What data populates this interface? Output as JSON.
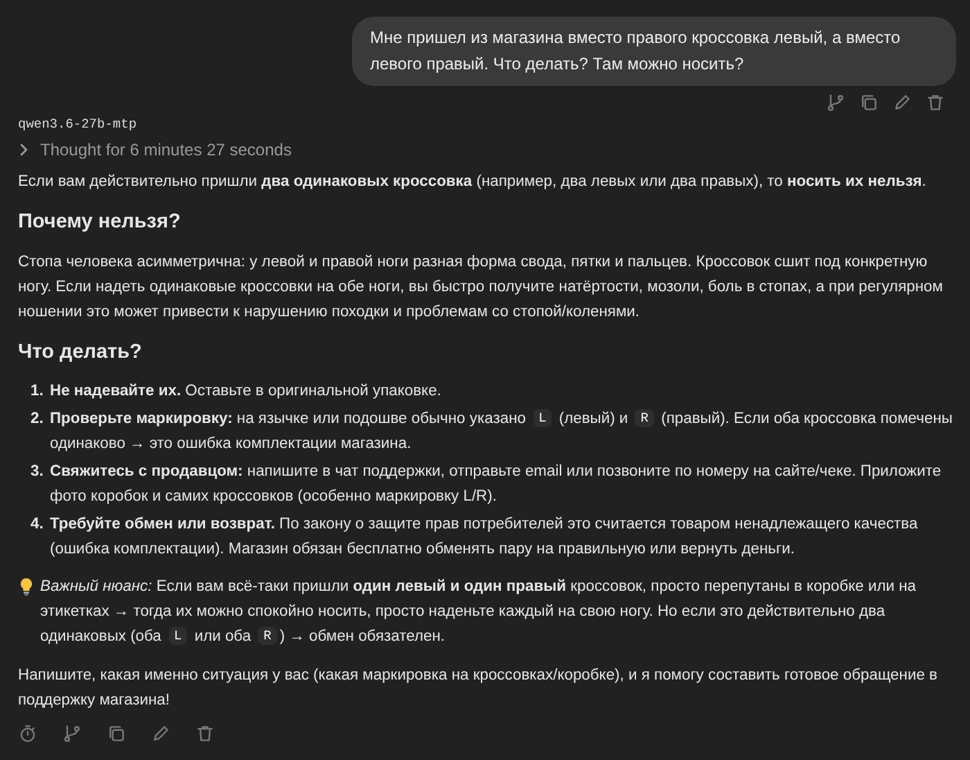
{
  "user_message": {
    "text": "Мне пришел из магазина вместо правого кроссовка левый, а вместо левого правый. Что делать? Там можно носить?"
  },
  "user_actions": [
    {
      "kind": "branch"
    },
    {
      "kind": "copy"
    },
    {
      "kind": "edit"
    },
    {
      "kind": "delete"
    }
  ],
  "model_name": "qwen3.6-27b-mtp",
  "thought": {
    "text": "Thought for 6 minutes 27 seconds",
    "expanded": false
  },
  "answer": [
    {
      "kind": "paragraph",
      "parts": [
        {
          "kind": "text",
          "text": "Если вам действительно пришли **два одинаковых кроссовка** (например, два левых или два правых), то **носить их нельзя**."
        }
      ]
    },
    {
      "kind": "heading",
      "text": "Почему нельзя?"
    },
    {
      "kind": "paragraph",
      "parts": [
        {
          "kind": "text",
          "text": "Стопа человека асимметрична: у левой и правой ноги разная форма свода, пятки и пальцев. Кроссовок сшит под конкретную ногу. Если надеть одинаковые кроссовки на обе ноги, вы быстро получите натёртости, мозоли, боль в стопах, а при регулярном ношении это может привести к нарушению походки и проблемам со стопой/коленями."
        }
      ]
    },
    {
      "kind": "heading",
      "text": "Что делать?"
    },
    {
      "kind": "list",
      "items": [
        {
          "number": "1.",
          "parts": [
            {
              "kind": "text",
              "text": "**Не надевайте их.** Оставьте в оригинальной упаковке."
            }
          ]
        },
        {
          "number": "2.",
          "parts": [
            {
              "kind": "text",
              "text": "**Проверьте маркировку:** на язычке или подошве обычно указано "
            },
            {
              "kind": "code",
              "text": "L"
            },
            {
              "kind": "text",
              "text": " (левый) и "
            },
            {
              "kind": "code",
              "text": "R"
            },
            {
              "kind": "text",
              "text": " (правый). Если оба кроссовка помечены одинаково → это ошибка комплектации магазина."
            }
          ]
        },
        {
          "number": "3.",
          "parts": [
            {
              "kind": "text",
              "text": "**Свяжитесь с продавцом:** напишите в чат поддержки, отправьте email или позвоните по номеру на сайте/чеке. Приложите фото коробок и самих кроссовков (особенно маркировку L/R)."
            }
          ]
        },
        {
          "number": "4.",
          "parts": [
            {
              "kind": "text",
              "text": "**Требуйте обмен или возврат.** По закону о защите прав потребителей это считается товаром ненадлежащего качества (ошибка комплектации). Магазин обязан бесплатно обменять пару на правильную или вернуть деньги."
            }
          ]
        }
      ]
    },
    {
      "kind": "tip",
      "parts": [
        {
          "kind": "text",
          "text": "*Важный нюанс:* Если вам всё-таки пришли **один левый и один правый** кроссовок, просто перепутаны в коробке или на этикетках → тогда их можно спокойно носить, просто наденьте каждый на свою ногу. Но если это действительно два одинаковых (оба "
        },
        {
          "kind": "code",
          "text": "L"
        },
        {
          "kind": "text",
          "text": " или оба "
        },
        {
          "kind": "code",
          "text": "R"
        },
        {
          "kind": "text",
          "text": ") → обмен обязателен."
        }
      ]
    },
    {
      "kind": "paragraph",
      "parts": [
        {
          "kind": "text",
          "text": "Напишите, какая именно ситуация у вас (какая маркировка на кроссовках/коробке), и я помогу составить готовое обращение в поддержку магазина!"
        }
      ]
    }
  ],
  "answer_actions": [
    {
      "kind": "timer"
    },
    {
      "kind": "branch"
    },
    {
      "kind": "copy"
    },
    {
      "kind": "edit"
    },
    {
      "kind": "delete"
    }
  ]
}
